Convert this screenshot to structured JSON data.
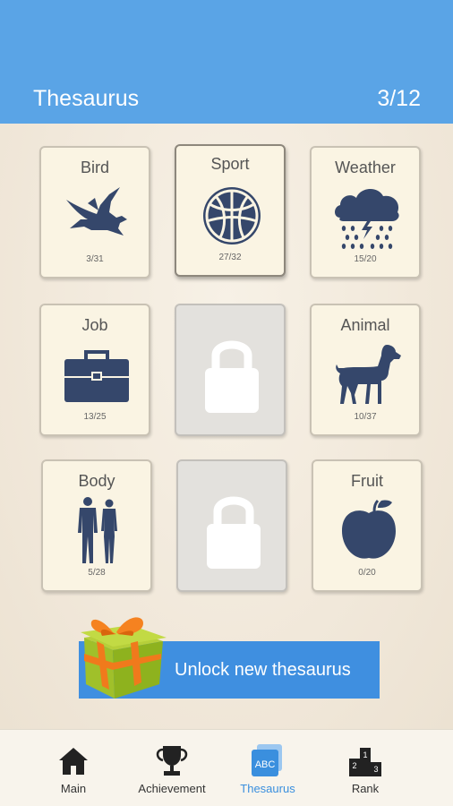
{
  "header": {
    "title": "Thesaurus",
    "count": "3/12"
  },
  "cards": [
    {
      "name": "Bird",
      "progress": "3/31",
      "icon": "bird-icon",
      "locked": false
    },
    {
      "name": "Sport",
      "progress": "27/32",
      "icon": "basketball-icon",
      "locked": false,
      "selected": true
    },
    {
      "name": "Weather",
      "progress": "15/20",
      "icon": "rain-cloud-icon",
      "locked": false
    },
    {
      "name": "Job",
      "progress": "13/25",
      "icon": "briefcase-icon",
      "locked": false
    },
    {
      "name": "",
      "progress": "",
      "icon": "lock-icon",
      "locked": true
    },
    {
      "name": "Animal",
      "progress": "10/37",
      "icon": "dog-icon",
      "locked": false
    },
    {
      "name": "Body",
      "progress": "5/28",
      "icon": "human-body-icon",
      "locked": false
    },
    {
      "name": "",
      "progress": "",
      "icon": "lock-icon",
      "locked": true
    },
    {
      "name": "Fruit",
      "progress": "0/20",
      "icon": "apple-icon",
      "locked": false
    }
  ],
  "unlock": {
    "label": "Unlock new thesaurus",
    "icon": "gift-box-icon"
  },
  "tabbar": {
    "tabs": [
      {
        "label": "Main",
        "icon": "house-icon"
      },
      {
        "label": "Achievement",
        "icon": "trophy-icon"
      },
      {
        "label": "Thesaurus",
        "icon": "abc-book-icon",
        "icon_text": "ABC",
        "active": true
      },
      {
        "label": "Rank",
        "icon": "podium-icon",
        "icon_text": [
          "2",
          "1",
          "3"
        ]
      }
    ]
  },
  "colors": {
    "header_bg": "#5aa4e6",
    "icon_navy": "#35476b",
    "unlock_bg": "#3f8fe0",
    "active_tab": "#3a8fde",
    "card_bg": "#faf4e3"
  }
}
